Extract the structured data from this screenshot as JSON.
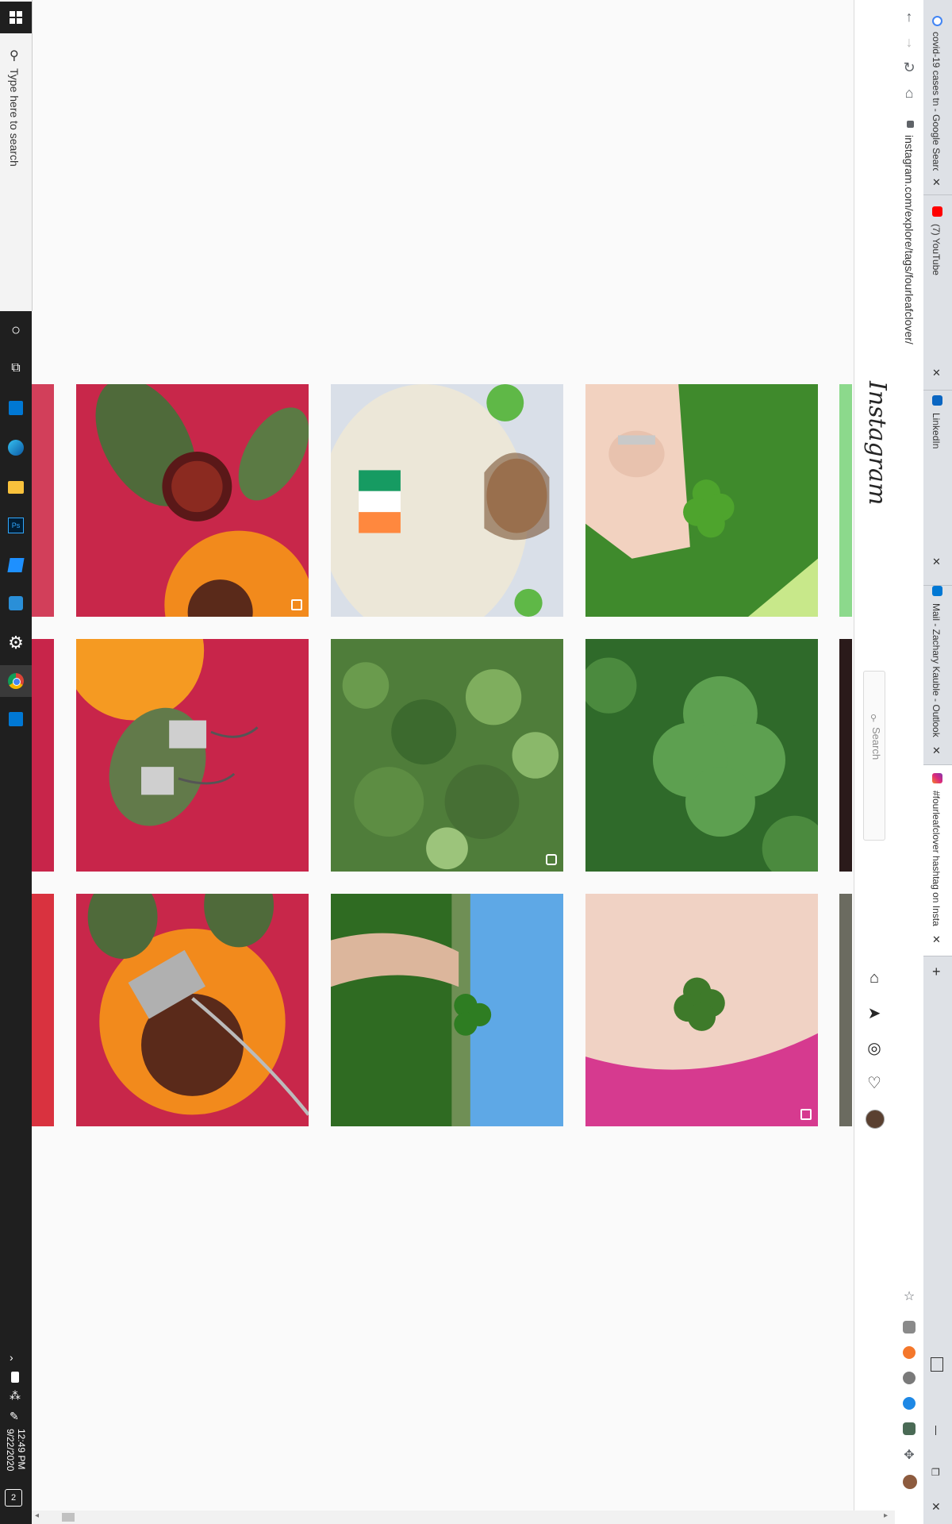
{
  "taskbar": {
    "search_placeholder": "Type here to search",
    "time": "12:49 PM",
    "date": "9/22/2020",
    "notification_count": "2",
    "icons": [
      "windows-start-icon",
      "search-icon",
      "cortana-icon",
      "task-view-icon",
      "store-icon",
      "edge-icon",
      "file-explorer-icon",
      "photoshop-icon",
      "app-icon",
      "network-app-icon",
      "settings-icon",
      "chrome-icon",
      "remote-desktop-icon"
    ]
  },
  "browser": {
    "tabs": [
      {
        "title": "covid-19 cases tn - Google Search",
        "favicon_color": "#4285f4"
      },
      {
        "title": "(7) YouTube",
        "favicon_color": "#ff0000"
      },
      {
        "title": "LinkedIn",
        "favicon_color": "#0a66c2"
      },
      {
        "title": "Mail - Zachary Kauble - Outlook",
        "favicon_color": "#0078d4"
      },
      {
        "title": "#fourleafclover hashtag on Insta",
        "favicon_color": "#e1306c"
      }
    ],
    "new_tab_label": "+",
    "url": "instagram.com/explore/tags/fourleafclover/"
  },
  "instagram": {
    "logo": "Instagram",
    "search_placeholder": "Search",
    "nav_icons": [
      "home-icon",
      "direct-icon",
      "explore-icon",
      "activity-icon",
      "profile-avatar"
    ]
  },
  "grid": {
    "tiles": [
      {
        "name": "tile-sunflower-ring",
        "desc_icon": "multi-post-icon"
      },
      {
        "name": "tile-irish-flag-man"
      },
      {
        "name": "tile-hand-clover"
      },
      {
        "name": "tile-sunflower-earrings"
      },
      {
        "name": "tile-clover-patch",
        "desc_icon": "video-icon"
      },
      {
        "name": "tile-clover-closeup"
      },
      {
        "name": "tile-sunflower-necklace"
      },
      {
        "name": "tile-sky-clover"
      },
      {
        "name": "tile-palm-clover",
        "desc_icon": "multi-post-icon"
      }
    ]
  },
  "colors": {
    "instagram_bg": "#fafafa",
    "taskbar": "#1f1f1f",
    "tabstrip": "#dee1e6",
    "accent_pink": "#e1306c"
  }
}
